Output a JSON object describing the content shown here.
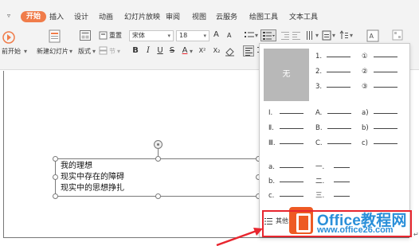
{
  "menu": {
    "items": [
      {
        "label": "开始",
        "active": true
      },
      {
        "label": "插入"
      },
      {
        "label": "设计"
      },
      {
        "label": "动画"
      },
      {
        "label": "幻灯片放映"
      },
      {
        "label": "审阅"
      },
      {
        "label": "视图"
      },
      {
        "label": "云服务"
      },
      {
        "label": "绘图工具"
      },
      {
        "label": "文本工具"
      }
    ]
  },
  "ribbon": {
    "play_label": "前开始",
    "new_slide_label": "新建幻灯片",
    "layout_label": "版式",
    "section_label": "节",
    "reset_label": "重置",
    "font_name": "宋体",
    "font_size": "18",
    "font_grow": "A",
    "font_shrink": "A",
    "bold": "B",
    "italic": "I",
    "underline": "U",
    "strike": "S",
    "font_color": "A",
    "superscript": "X²",
    "subscript": "X₂",
    "accent_color": "#f07c4a"
  },
  "textbox": {
    "lines": [
      "我的理想",
      "现实中存在的障碍",
      "现实中的思想挣扎"
    ]
  },
  "list_panel": {
    "none_label": "无",
    "numbered_a": [
      "1.",
      "2.",
      "3."
    ],
    "numbered_b": [
      "①",
      "②",
      "③"
    ],
    "roman": [
      "Ⅰ.",
      "Ⅱ.",
      "Ⅲ."
    ],
    "upper_alpha": [
      "A.",
      "B.",
      "C."
    ],
    "lower_alpha_paren": [
      "a)",
      "b)",
      "c)"
    ],
    "lower_alpha": [
      "a.",
      "b.",
      "c."
    ],
    "chinese": [
      "一.",
      "二.",
      "三."
    ],
    "other_label": "其他"
  },
  "watermark": {
    "title": "Office教程网",
    "url": "www.office26.com",
    "logo_color": "#ee5a24",
    "text_color": "#2a8fd9"
  },
  "annotation": {
    "highlight_color": "#e8262f"
  }
}
